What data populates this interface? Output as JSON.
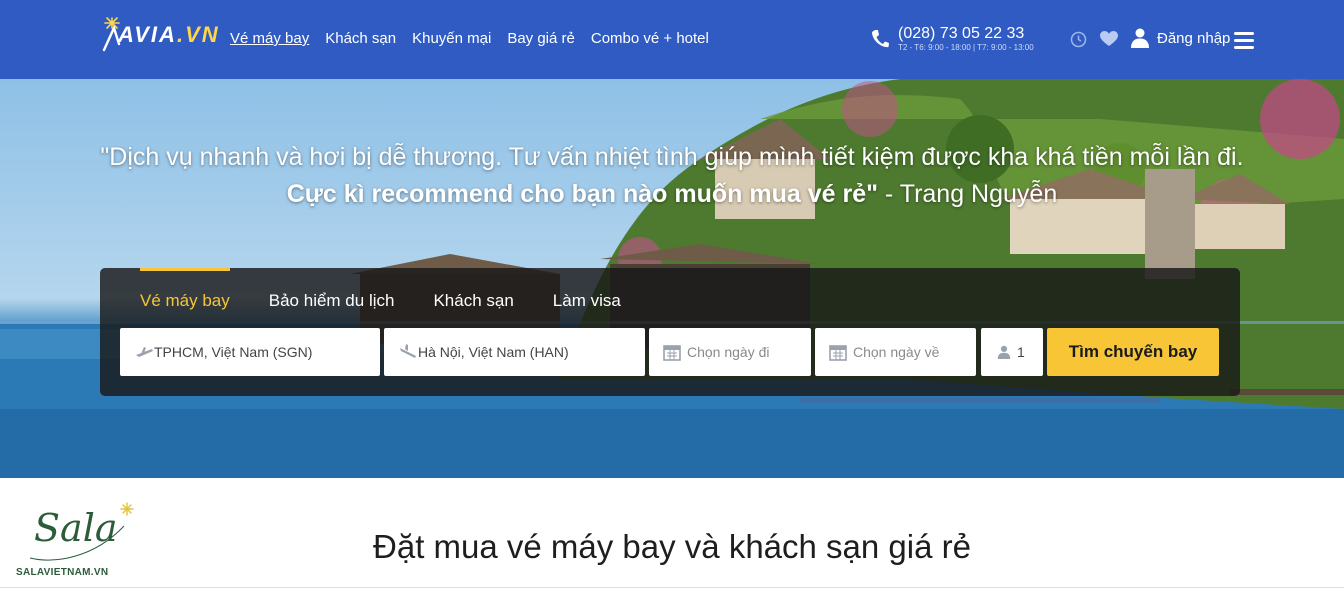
{
  "header": {
    "logo": {
      "text_main": "AVIA",
      "text_dot": ".",
      "text_suffix": "VN"
    },
    "nav": [
      {
        "label": "Vé máy bay",
        "active": true
      },
      {
        "label": "Khách sạn"
      },
      {
        "label": "Khuyến mại"
      },
      {
        "label": "Bay giá rẻ"
      },
      {
        "label": "Combo vé + hotel"
      }
    ],
    "phone": "(028) 73 05 22 33",
    "hours": "T2 - T6: 9:00 - 18:00 | T7: 9:00 - 13:00",
    "login_label": "Đăng nhập",
    "icons": [
      "phone-icon",
      "clock-icon",
      "heart-icon",
      "user-icon",
      "menu-icon"
    ],
    "bg_color": "#2f5bc3"
  },
  "hero": {
    "quote_line1": "\"Dịch vụ nhanh và hơi bị dễ thương. Tư vấn nhiệt tình giúp mình tiết kiệm được kha khá tiền mỗi lần đi.",
    "quote_bold": "Cực kì recommend cho bạn nào muốn mua vé rẻ\"",
    "quote_author": " - Trang Nguyễn",
    "search": {
      "tabs": [
        {
          "label": "Vé máy bay",
          "active": true
        },
        {
          "label": "Bảo hiểm du lịch"
        },
        {
          "label": "Khách sạn"
        },
        {
          "label": "Làm visa"
        }
      ],
      "from_value": "TPHCM, Việt Nam (SGN)",
      "to_value": "Hà Nội, Việt Nam (HAN)",
      "depart_placeholder": "Chọn ngày đi",
      "return_placeholder": "Chọn ngày về",
      "passengers": "1",
      "submit_label": "Tìm chuyến bay",
      "accent_color": "#f7c535"
    }
  },
  "section": {
    "brand_name": "Sala",
    "brand_site": "SALAVIETNAM.VN",
    "headline": "Đặt mua vé máy bay và khách sạn giá rẻ"
  }
}
